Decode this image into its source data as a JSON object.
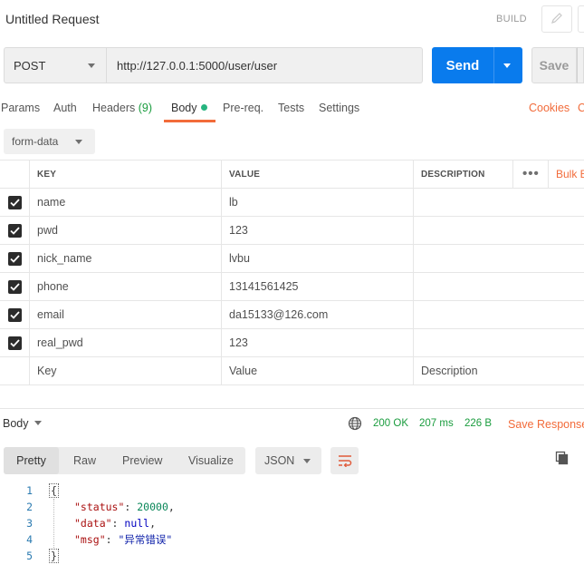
{
  "header": {
    "title": "Untitled Request",
    "build_label": "BUILD"
  },
  "request": {
    "method": "POST",
    "url": "http://127.0.0.1:5000/user/user",
    "send_label": "Send",
    "save_label": "Save"
  },
  "tabs": {
    "params": "Params",
    "auth": "Auth",
    "headers": "Headers",
    "headers_count": "(9)",
    "body": "Body",
    "prereq": "Pre-req.",
    "tests": "Tests",
    "settings": "Settings",
    "cookies": "Cookies",
    "code": "C"
  },
  "body_type": "form-data",
  "table": {
    "columns": {
      "key": "KEY",
      "value": "VALUE",
      "description": "DESCRIPTION",
      "bulk": "Bulk Edit"
    },
    "rows": [
      {
        "key": "name",
        "value": "lb"
      },
      {
        "key": "pwd",
        "value": "123"
      },
      {
        "key": "nick_name",
        "value": "lvbu"
      },
      {
        "key": "phone",
        "value": "13141561425"
      },
      {
        "key": "email",
        "value": "da15133@126.com"
      },
      {
        "key": "real_pwd",
        "value": "123"
      }
    ],
    "placeholders": {
      "key": "Key",
      "value": "Value",
      "description": "Description"
    }
  },
  "response": {
    "body_label": "Body",
    "status": "200 OK",
    "time": "207 ms",
    "size": "226 B",
    "save_label": "Save Response",
    "views": [
      "Pretty",
      "Raw",
      "Preview",
      "Visualize"
    ],
    "format": "JSON"
  },
  "code_lines": {
    "l1": "1",
    "l2": "2",
    "l3": "3",
    "l4": "4",
    "l5": "5",
    "open": "{",
    "close": "}",
    "k_status": "\"status\"",
    "v_status": "20000",
    "k_data": "\"data\"",
    "v_data": "null",
    "k_msg": "\"msg\"",
    "v_msg": "\"异常错误\"",
    "colon": ": ",
    "comma": ","
  },
  "colors": {
    "accent": "#f26b3a",
    "send": "#097bed",
    "ok": "#1a9c3e"
  }
}
